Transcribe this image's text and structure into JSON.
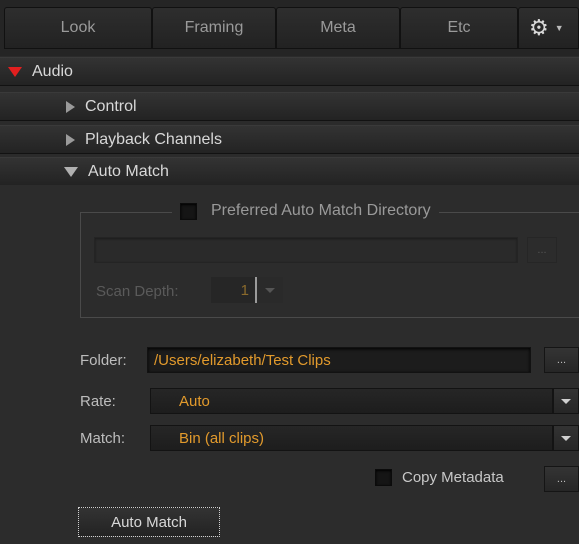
{
  "tabs": [
    {
      "label": "Look"
    },
    {
      "label": "Framing"
    },
    {
      "label": "Meta"
    },
    {
      "label": "Etc"
    }
  ],
  "settings_icon": "gear-icon",
  "sections": {
    "audio": "Audio",
    "control": "Control",
    "playback_channels": "Playback Channels",
    "auto_match": "Auto Match"
  },
  "preferred_group": {
    "label": "Preferred Auto Match Directory",
    "checked": false,
    "path_value": "",
    "browse_label": "...",
    "scan_depth_label": "Scan Depth:",
    "scan_depth_value": "1"
  },
  "folder": {
    "label": "Folder:",
    "value": "/Users/elizabeth/Test Clips",
    "browse_label": "..."
  },
  "rate": {
    "label": "Rate:",
    "value": "Auto"
  },
  "match": {
    "label": "Match:",
    "value": "Bin (all clips)"
  },
  "copy_metadata": {
    "label": "Copy Metadata",
    "checked": false,
    "browse_label": "..."
  },
  "auto_match_button": "Auto Match",
  "colors": {
    "accent_value": "#e29a2c",
    "audio_triangle": "#e21f1f",
    "background": "#2b2b2b"
  }
}
